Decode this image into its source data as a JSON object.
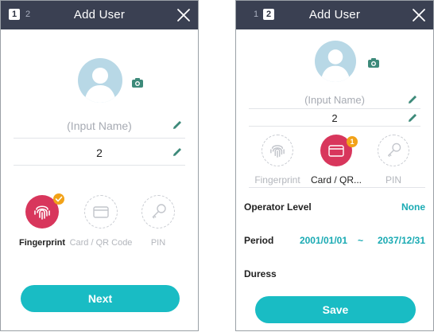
{
  "colors": {
    "header": "#3a4052",
    "accent": "#19bcc4",
    "credential_active": "#d8365c",
    "badge": "#f2a218"
  },
  "panel1": {
    "title": "Add User",
    "steps": [
      "1",
      "2"
    ],
    "name_placeholder": "(Input Name)",
    "user_id": "2",
    "credentials": [
      {
        "label": "Fingerprint",
        "icon": "fingerprint-icon",
        "active": true
      },
      {
        "label": "Card / QR Code",
        "icon": "card-icon",
        "active": false
      },
      {
        "label": "PIN",
        "icon": "key-icon",
        "active": false
      }
    ],
    "next_label": "Next"
  },
  "panel2": {
    "title": "Add User",
    "steps": [
      "1",
      "2"
    ],
    "name_placeholder": "(Input Name)",
    "user_id": "2",
    "credentials": [
      {
        "label": "Fingerprint",
        "icon": "fingerprint-icon",
        "active": false
      },
      {
        "label": "Card / QR...",
        "icon": "card-icon",
        "active": true,
        "badge": "1"
      },
      {
        "label": "PIN",
        "icon": "key-icon",
        "active": false
      }
    ],
    "operator_level": {
      "label": "Operator Level",
      "value": "None"
    },
    "period": {
      "label": "Period",
      "start": "2001/01/01",
      "separator": "~",
      "end": "2037/12/31"
    },
    "duress": {
      "label": "Duress"
    },
    "save_label": "Save"
  }
}
